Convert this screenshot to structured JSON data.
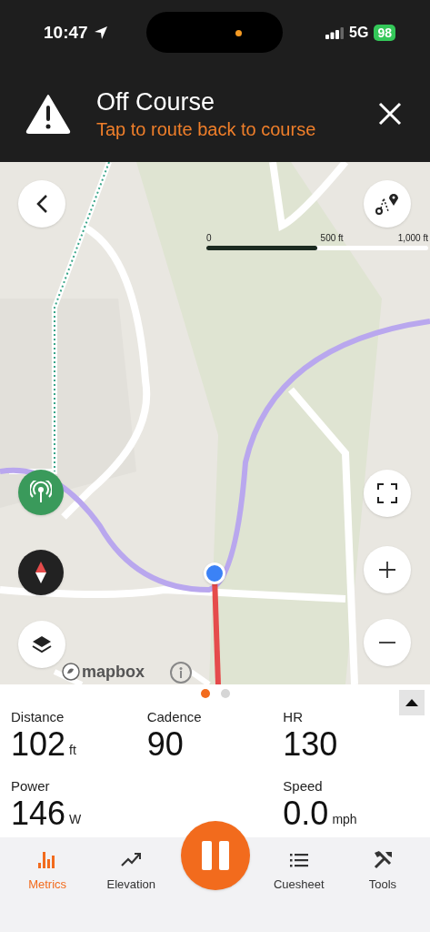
{
  "status_bar": {
    "time": "10:47",
    "network": "5G",
    "battery": "98"
  },
  "banner": {
    "title": "Off Course",
    "subtitle": "Tap to route back to course"
  },
  "map": {
    "kind": "picture",
    "scale": {
      "labels": [
        "0",
        "500 ft",
        "1,000 ft"
      ],
      "level": 0.5
    },
    "attribution": "mapbox"
  },
  "pager": [
    {
      "selected": true
    },
    {
      "selected": false
    }
  ],
  "metrics": [
    {
      "label": "Distance",
      "value": "102",
      "unit": "ft"
    },
    {
      "label": "Cadence",
      "value": "90"
    },
    {
      "label": "HR",
      "value": "130"
    },
    {
      "label": "Power",
      "value": "146",
      "unit": "W"
    },
    {
      "label": "Speed",
      "value": "0.0",
      "unit": "mph"
    }
  ],
  "tabs": [
    {
      "label": "Metrics",
      "selected": true
    },
    {
      "label": "Elevation",
      "selected": false
    },
    {
      "kind": "pause"
    },
    {
      "label": "Cuesheet",
      "selected": false
    },
    {
      "label": "Tools",
      "selected": false
    }
  ]
}
